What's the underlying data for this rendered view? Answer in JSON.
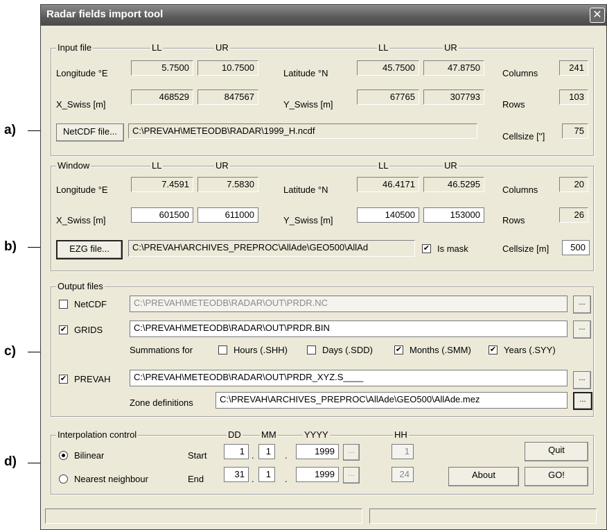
{
  "window": {
    "title": "Radar fields import tool",
    "close": "✕"
  },
  "markers": {
    "a": "a)",
    "b": "b)",
    "c": "c)",
    "d": "d)"
  },
  "input": {
    "legend": "Input file",
    "ll": "LL",
    "ur": "UR",
    "lon_label": "Longitude °E",
    "lon_ll": "5.7500",
    "lon_ur": "10.7500",
    "lat_label": "Latitude °N",
    "lat_ll": "45.7500",
    "lat_ur": "47.8750",
    "xs_label": "X_Swiss [m]",
    "xs_ll": "468529",
    "xs_ur": "847567",
    "ys_label": "Y_Swiss [m]",
    "ys_ll": "67765",
    "ys_ur": "307793",
    "cols_label": "Columns",
    "cols": "241",
    "rows_label": "Rows",
    "rows": "103",
    "file_button": "NetCDF file...",
    "file_path": "C:\\PREVAH\\METEODB\\RADAR\\1999_H.ncdf",
    "cell_label": "Cellsize ['']",
    "cell": "75"
  },
  "window_group": {
    "legend": "Window",
    "ll": "LL",
    "ur": "UR",
    "lon_label": "Longitude °E",
    "lon_ll": "7.4591",
    "lon_ur": "7.5830",
    "lat_label": "Latitude °N",
    "lat_ll": "46.4171",
    "lat_ur": "46.5295",
    "xs_label": "X_Swiss [m]",
    "xs_ll": "601500",
    "xs_ur": "611000",
    "ys_label": "Y_Swiss [m]",
    "ys_ll": "140500",
    "ys_ur": "153000",
    "cols_label": "Columns",
    "cols": "20",
    "rows_label": "Rows",
    "rows": "26",
    "file_button": "EZG file...",
    "file_path": "C:\\PREVAH\\ARCHIVES_PREPROC\\AllAde\\GEO500\\AllAd",
    "mask_label": "Is mask",
    "mask_checked": "✔",
    "cell_label": "Cellsize [m]",
    "cell": "500"
  },
  "output": {
    "legend": "Output files",
    "netcdf_label": "NetCDF",
    "netcdf_checked": "",
    "netcdf_path": "C:\\PREVAH\\METEODB\\RADAR\\OUT\\PRDR.NC",
    "grids_label": "GRIDS",
    "grids_checked": "✔",
    "grids_path": "C:\\PREVAH\\METEODB\\RADAR\\OUT\\PRDR.BIN",
    "summations_label": "Summations for",
    "hours_label": "Hours (.SHH)",
    "hours_checked": "",
    "days_label": "Days (.SDD)",
    "days_checked": "",
    "months_label": "Months (.SMM)",
    "months_checked": "✔",
    "years_label": "Years (.SYY)",
    "years_checked": "✔",
    "prevah_label": "PREVAH",
    "prevah_checked": "✔",
    "prevah_path": "C:\\PREVAH\\METEODB\\RADAR\\OUT\\PRDR_XYZ.S____",
    "zone_label": "Zone definitions",
    "zone_path": "C:\\PREVAH\\ARCHIVES_PREPROC\\AllAde\\GEO500\\AllAde.mez",
    "browse": "..."
  },
  "interp": {
    "legend": "Interpolation control",
    "bilinear_label": "Bilinear",
    "nearest_label": "Nearest neighbour",
    "dd": "DD",
    "mm": "MM",
    "yyyy": "YYYY",
    "hh": "HH",
    "start_label": "Start",
    "start_dd": "1",
    "start_mm": "1",
    "start_yyyy": "1999",
    "start_hh": "1",
    "end_label": "End",
    "end_dd": "31",
    "end_mm": "1",
    "end_yyyy": "1999",
    "end_hh": "24",
    "dot": ".",
    "browse": "...",
    "quit": "Quit",
    "about": "About",
    "go": "GO!"
  }
}
